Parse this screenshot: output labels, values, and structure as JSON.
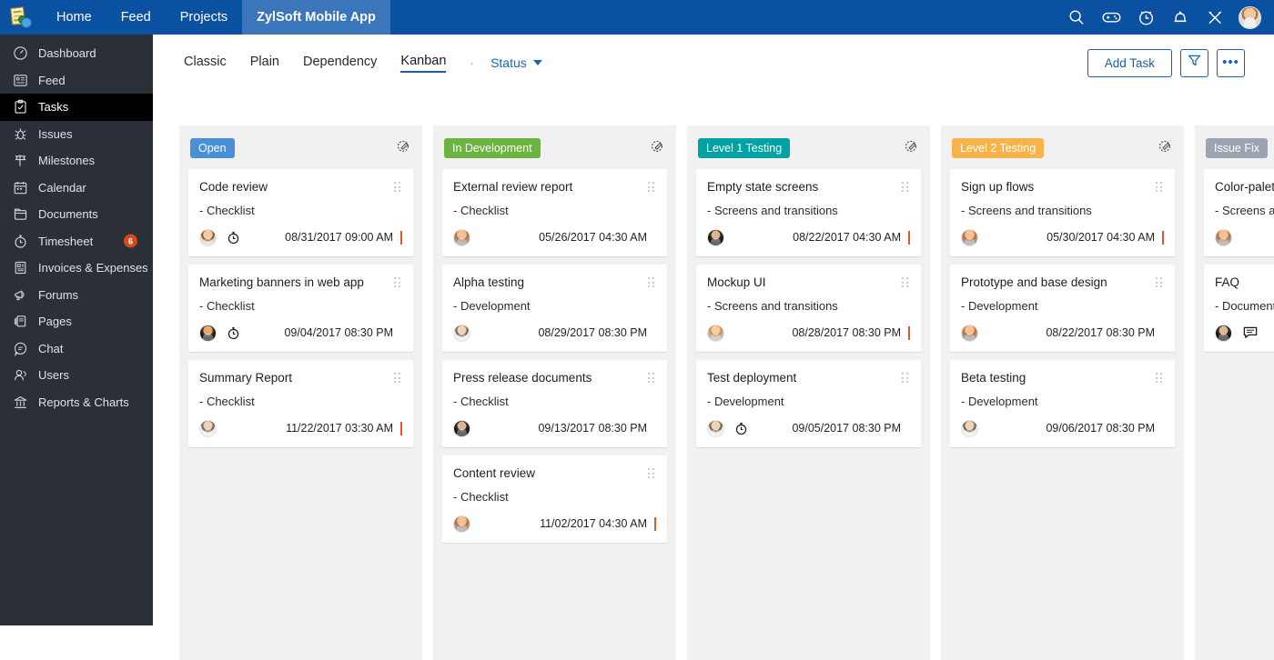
{
  "topbar": {
    "logo_icon": "zylsoft-logo-icon",
    "nav": [
      {
        "label": "Home",
        "active": false
      },
      {
        "label": "Feed",
        "active": false
      },
      {
        "label": "Projects",
        "active": false
      },
      {
        "label": "ZylSoft Mobile App",
        "active": true
      }
    ],
    "icons": [
      "search-icon",
      "gamepad-icon",
      "timer-clock-icon",
      "bell-icon",
      "tools-icon"
    ],
    "avatar": "user-avatar",
    "bg_color": "#0b51a1",
    "active_tab_color": "#3b76bb"
  },
  "sidebar": {
    "bg_color": "#2b3038",
    "items": [
      {
        "label": "Dashboard",
        "icon": "dashboard-icon",
        "active": false,
        "badge": ""
      },
      {
        "label": "Feed",
        "icon": "feed-icon",
        "active": false,
        "badge": ""
      },
      {
        "label": "Tasks",
        "icon": "tasks-clipboard-icon",
        "active": true,
        "badge": ""
      },
      {
        "label": "Issues",
        "icon": "bug-icon",
        "active": false,
        "badge": ""
      },
      {
        "label": "Milestones",
        "icon": "milestone-flag-icon",
        "active": false,
        "badge": ""
      },
      {
        "label": "Calendar",
        "icon": "calendar-icon",
        "active": false,
        "badge": ""
      },
      {
        "label": "Documents",
        "icon": "documents-folder-icon",
        "active": false,
        "badge": ""
      },
      {
        "label": "Timesheet",
        "icon": "stopwatch-icon",
        "active": false,
        "badge": "6"
      },
      {
        "label": "Invoices & Expenses",
        "icon": "invoice-icon",
        "active": false,
        "badge": ""
      },
      {
        "label": "Forums",
        "icon": "megaphone-icon",
        "active": false,
        "badge": ""
      },
      {
        "label": "Pages",
        "icon": "pages-icon",
        "active": false,
        "badge": ""
      },
      {
        "label": "Chat",
        "icon": "chat-bubble-icon",
        "active": false,
        "badge": ""
      },
      {
        "label": "Users",
        "icon": "users-icon",
        "active": false,
        "badge": ""
      },
      {
        "label": "Reports & Charts",
        "icon": "bank-chart-icon",
        "active": false,
        "badge": ""
      }
    ],
    "badge_color": "#d2491e"
  },
  "subbar": {
    "views": [
      {
        "label": "Classic",
        "active": false
      },
      {
        "label": "Plain",
        "active": false
      },
      {
        "label": "Dependency",
        "active": false
      },
      {
        "label": "Kanban",
        "active": true
      }
    ],
    "separator": "·",
    "status_label": "Status",
    "add_task_label": "Add Task",
    "filter_icon": "filter-funnel-icon",
    "more_icon": "more-options-icon",
    "more_label": "•••",
    "accent_color": "#1a5fa8"
  },
  "board": {
    "columns": [
      {
        "title": "Open",
        "badge_color": "#4a90d9",
        "edit_icon": "edit-pencil-icon",
        "cards": [
          {
            "title": "Code review",
            "sub": "- Checklist",
            "avatar": "ava-a",
            "timer": true,
            "date": "08/31/2017 09:00 AM",
            "flag": true,
            "chat": false
          },
          {
            "title": "Marketing banners in web app",
            "sub": "- Checklist",
            "avatar": "ava-b",
            "timer": true,
            "date": "09/04/2017 08:30 PM",
            "flag": false,
            "chat": false
          },
          {
            "title": "Summary Report",
            "sub": "- Checklist",
            "avatar": "ava-d",
            "timer": false,
            "date": "11/22/2017 03:30 AM",
            "flag": true,
            "chat": false
          }
        ]
      },
      {
        "title": "In Development",
        "badge_color": "#6cb33f",
        "edit_icon": "edit-pencil-icon",
        "cards": [
          {
            "title": "External review report",
            "sub": "- Checklist",
            "avatar": "ava-e",
            "timer": false,
            "date": "05/26/2017 04:30 AM",
            "flag": false,
            "chat": false
          },
          {
            "title": "Alpha testing",
            "sub": "- Development",
            "avatar": "ava-d",
            "timer": false,
            "date": "08/29/2017 08:30 PM",
            "flag": false,
            "chat": false
          },
          {
            "title": "Press release documents",
            "sub": "- Checklist",
            "avatar": "ava-c",
            "timer": false,
            "date": "09/13/2017 08:30 PM",
            "flag": false,
            "chat": false
          },
          {
            "title": "Content review",
            "sub": "- Checklist",
            "avatar": "ava-e",
            "timer": false,
            "date": "11/02/2017 04:30 AM",
            "flag": true,
            "chat": false
          }
        ]
      },
      {
        "title": "Level 1 Testing",
        "badge_color": "#00a3a3",
        "edit_icon": "edit-pencil-icon",
        "cards": [
          {
            "title": "Empty state screens",
            "sub": "- Screens and transitions",
            "avatar": "ava-c",
            "timer": false,
            "date": "08/22/2017 04:30 AM",
            "flag": true,
            "chat": false
          },
          {
            "title": "Mockup UI",
            "sub": "- Screens and transitions",
            "avatar": "ava-f",
            "timer": false,
            "date": "08/28/2017 08:30 PM",
            "flag": true,
            "chat": false
          },
          {
            "title": "Test deployment",
            "sub": "- Development",
            "avatar": "ava-d",
            "timer": true,
            "date": "09/05/2017 08:30 PM",
            "flag": false,
            "chat": false
          }
        ]
      },
      {
        "title": "Level 2 Testing",
        "badge_color": "#f7b24a",
        "edit_icon": "edit-pencil-icon",
        "cards": [
          {
            "title": "Sign up flows",
            "sub": "- Screens and transitions",
            "avatar": "ava-e",
            "timer": false,
            "date": "05/30/2017 04:30 AM",
            "flag": true,
            "chat": false
          },
          {
            "title": "Prototype and base design",
            "sub": "- Development",
            "avatar": "ava-e",
            "timer": false,
            "date": "08/22/2017 08:30 PM",
            "flag": false,
            "chat": false
          },
          {
            "title": "Beta testing",
            "sub": "- Development",
            "avatar": "ava-d",
            "timer": false,
            "date": "09/06/2017 08:30 PM",
            "flag": false,
            "chat": false
          }
        ]
      },
      {
        "title": "Issue Fix",
        "badge_color": "#9aa5b1",
        "edit_icon": "edit-pencil-icon",
        "cards": [
          {
            "title": "Color-palette",
            "sub": "- Screens and transitions",
            "avatar": "ava-e",
            "timer": false,
            "date": "",
            "flag": false,
            "chat": false
          },
          {
            "title": "FAQ",
            "sub": "- Documentation",
            "avatar": "ava-c",
            "timer": false,
            "date": "",
            "flag": false,
            "chat": true
          }
        ]
      }
    ]
  }
}
